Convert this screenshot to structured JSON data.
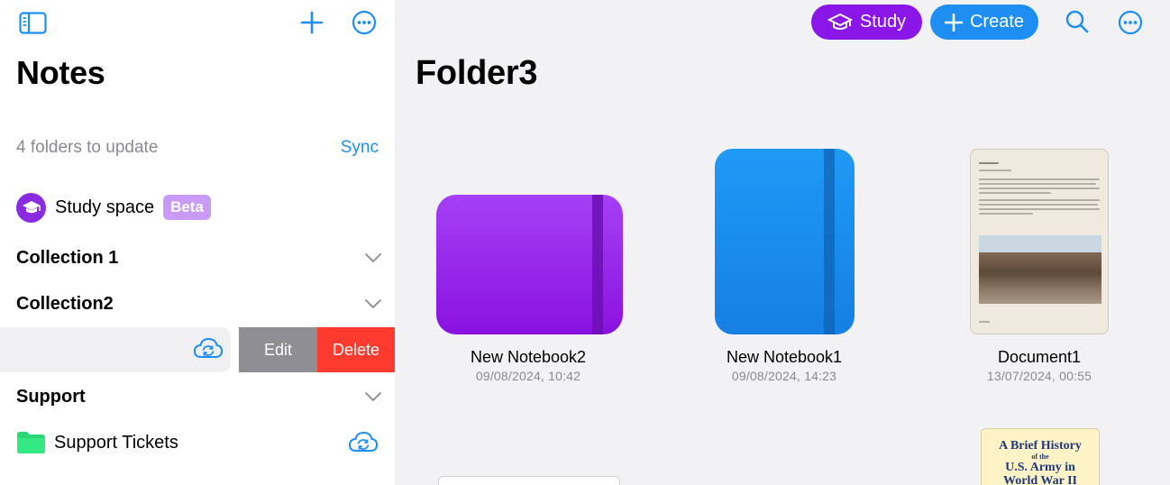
{
  "sidebar": {
    "title": "Notes",
    "update_text": "4 folders to update",
    "sync_label": "Sync",
    "study_space_label": "Study space",
    "beta_label": "Beta",
    "sections": [
      "Collection 1",
      "Collection2",
      "Support"
    ],
    "swipe_actions": {
      "edit": "Edit",
      "delete": "Delete"
    },
    "support_tickets_label": "Support Tickets"
  },
  "toolbar": {
    "study_label": "Study",
    "create_label": "Create"
  },
  "main": {
    "title": "Folder3",
    "items": [
      {
        "name": "New Notebook2",
        "date": "09/08/2024, 10:42"
      },
      {
        "name": "New Notebook1",
        "date": "09/08/2024, 14:23"
      },
      {
        "name": "Document1",
        "date": "13/07/2024, 00:55"
      }
    ],
    "partial_book_cover": {
      "line1": "A Brief History",
      "line2": "of the",
      "line3": "U.S. Army in",
      "line4": "World War II"
    }
  },
  "colors": {
    "accent": "#1e8ef3",
    "study_purple": "#8a17e8",
    "delete_red": "#ff3b30",
    "edit_gray": "#8e8e93",
    "folder_green": "#2ee07a"
  },
  "icons": {
    "sidebar_toggle": "sidebar-toggle-icon",
    "add": "plus-icon",
    "more": "ellipsis-circle-icon",
    "search": "search-icon",
    "graduation_cap": "graduation-cap-icon",
    "chevron": "chevron-down-icon",
    "cloud_sync": "cloud-sync-icon",
    "folder": "folder-icon"
  }
}
